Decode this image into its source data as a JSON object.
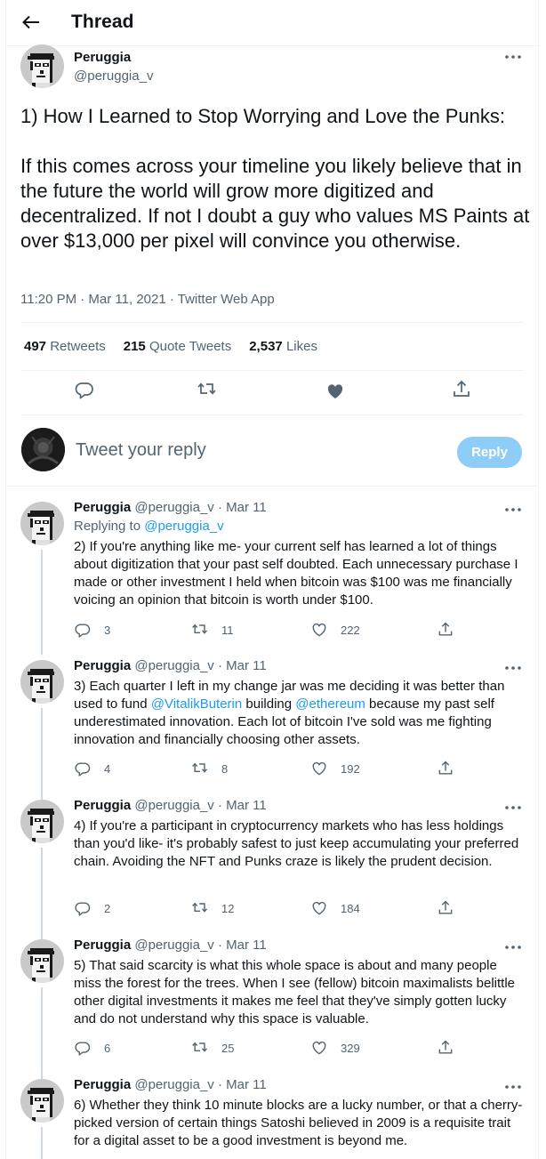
{
  "header": {
    "title": "Thread",
    "back_icon": "arrow-left-icon"
  },
  "main_tweet": {
    "name": "Peruggia",
    "handle": "@peruggia_v",
    "text": "1) How I Learned to Stop Worrying and Love the Punks:\n\nIf this comes across your timeline you likely believe that in the future the world will grow more digitized and decentralized. If not I doubt a guy who values MS Paints at over $13,000 per pixel will convince you otherwise.",
    "meta": "11:20 PM · Mar 11, 2021 · Twitter Web App",
    "stats": {
      "retweets_count": "497",
      "retweets_label": "Retweets",
      "quotes_count": "215",
      "quotes_label": "Quote Tweets",
      "likes_count": "2,537",
      "likes_label": "Likes"
    }
  },
  "reply_box": {
    "placeholder": "Tweet your reply",
    "button": "Reply"
  },
  "thread": [
    {
      "name": "Peruggia",
      "handle": "@peruggia_v · Mar 11",
      "replying_prefix": "Replying to ",
      "replying_to": "@peruggia_v",
      "text": "2) If you're anything like me- your current self has learned a lot of things about digitization that your past self doubted. Each unnecessary purchase I made or other investment I held when bitcoin was $100 was me financially voicing an opinion that bitcoin is worth under $100.",
      "replies": "3",
      "retweets": "11",
      "likes": "222"
    },
    {
      "name": "Peruggia",
      "handle": "@peruggia_v · Mar 11",
      "text_a": "3) Each quarter I left in my change jar was me deciding it was better than used to fund ",
      "mention_1": "@VitalikButerin",
      "text_b": " building ",
      "mention_2": "@ethereum",
      "text_c": " because my past self underestimated innovation. Each lot of bitcoin I've sold was me fighting innovation and financially choosing other assets.",
      "replies": "4",
      "retweets": "8",
      "likes": "192"
    },
    {
      "name": "Peruggia",
      "handle": "@peruggia_v · Mar 11",
      "text": "4) If you're a participant in cryptocurrency markets who has less holdings than you'd like- it's probably safest to just keep accumulating your preferred chain. Avoiding the NFT and Punks craze is likely the prudent decision.",
      "replies": "2",
      "retweets": "12",
      "likes": "184"
    },
    {
      "name": "Peruggia",
      "handle": "@peruggia_v · Mar 11",
      "text": "5) That said scarcity is what this whole space is about and many people miss the forest for the trees. When I see (fellow) bitcoin maximalists belittle other digital investments it makes me feel that they've simply gotten lucky and do not understand why this space is valuable.",
      "replies": "6",
      "retweets": "25",
      "likes": "329"
    },
    {
      "name": "Peruggia",
      "handle": "@peruggia_v · Mar 11",
      "text": "6) Whether they think 10 minute blocks are a lucky number, or that a cherry-picked version of certain things Satoshi believed in 2009 is a requisite trait for a digital asset to be a good investment is beyond me."
    }
  ],
  "colors": {
    "link": "#1d9bf0",
    "muted": "#536471",
    "reply_button": "#8ecdf8",
    "heart_filled": "#536471"
  },
  "icons": [
    "arrow-left-icon",
    "more-icon",
    "reply-icon",
    "retweet-icon",
    "heart-icon",
    "share-icon"
  ]
}
